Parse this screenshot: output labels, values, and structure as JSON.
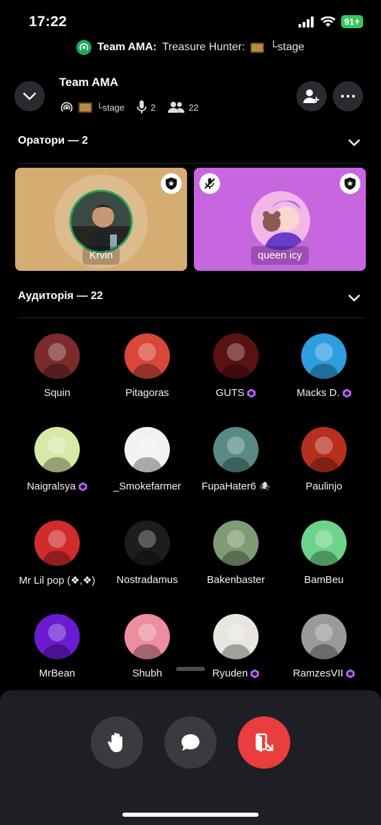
{
  "status_bar": {
    "time": "17:22",
    "battery": "91"
  },
  "banner": {
    "title": "Team AMA:",
    "subtitle": "Treasure Hunter:",
    "suffix": "└stage"
  },
  "header": {
    "title": "Team AMA",
    "stage_label": "└stage",
    "speakers_count": "2",
    "listeners_count": "22"
  },
  "speakers_section": {
    "title": "Оратори — 2"
  },
  "speakers": [
    {
      "name": "Krvin",
      "bg": "#d5ad73",
      "moderator": true,
      "muted": false
    },
    {
      "name": "queen icy",
      "bg": "#c866e0",
      "moderator": true,
      "muted": true
    }
  ],
  "audience_section": {
    "title": "Аудиторія — 22"
  },
  "audience": [
    {
      "name": "Squin",
      "boost": false,
      "color": "#7a2b2b",
      "icon": "avatar-squin"
    },
    {
      "name": "Pitagoras",
      "boost": false,
      "color": "#d8473a",
      "icon": "avatar-pitagoras"
    },
    {
      "name": "GUTS",
      "boost": true,
      "color": "#5a1212",
      "icon": "avatar-guts"
    },
    {
      "name": "Macks D.",
      "boost": true,
      "color": "#2f9ee0",
      "icon": "avatar-macks"
    },
    {
      "name": "Naigralsya",
      "boost": true,
      "color": "#d7e9a6",
      "icon": "avatar-naigralsya"
    },
    {
      "name": "_Smokefarmer",
      "boost": false,
      "color": "#f2f2f2",
      "icon": "avatar-smokefarmer"
    },
    {
      "name": "FupaHater6",
      "boost": false,
      "spider": true,
      "color": "#5a8a86",
      "icon": "avatar-fupahater"
    },
    {
      "name": "Paulinjo",
      "boost": false,
      "color": "#b7301f",
      "icon": "avatar-paulinjo"
    },
    {
      "name": "Mr Lil pop (❖,❖)",
      "boost": false,
      "color": "#d02c2c",
      "icon": "avatar-mrlilpop"
    },
    {
      "name": "Nostradamus",
      "boost": false,
      "color": "#1d1d1d",
      "icon": "avatar-nostradamus"
    },
    {
      "name": "Bakenbaster",
      "boost": false,
      "color": "#7f9c74",
      "icon": "avatar-bakenbaster"
    },
    {
      "name": "BamBeu",
      "boost": false,
      "color": "#6dd48c",
      "icon": "avatar-bambeu"
    },
    {
      "name": "MrBean",
      "boost": false,
      "color": "#6b1bd1",
      "icon": "avatar-mrbean"
    },
    {
      "name": "Shubh",
      "boost": false,
      "color": "#ec8ea0",
      "icon": "avatar-shubh"
    },
    {
      "name": "Ryuden",
      "boost": true,
      "color": "#e9e6e1",
      "icon": "avatar-ryuden"
    },
    {
      "name": "RamzesVII",
      "boost": true,
      "color": "#9a9a9a",
      "icon": "avatar-ramzes"
    }
  ],
  "controls": {
    "hand": "raise-hand",
    "chat": "chat",
    "leave": "leave"
  },
  "colors": {
    "leave": "#ea3d3d",
    "boost": "#c06bff",
    "online": "#23a55a"
  }
}
